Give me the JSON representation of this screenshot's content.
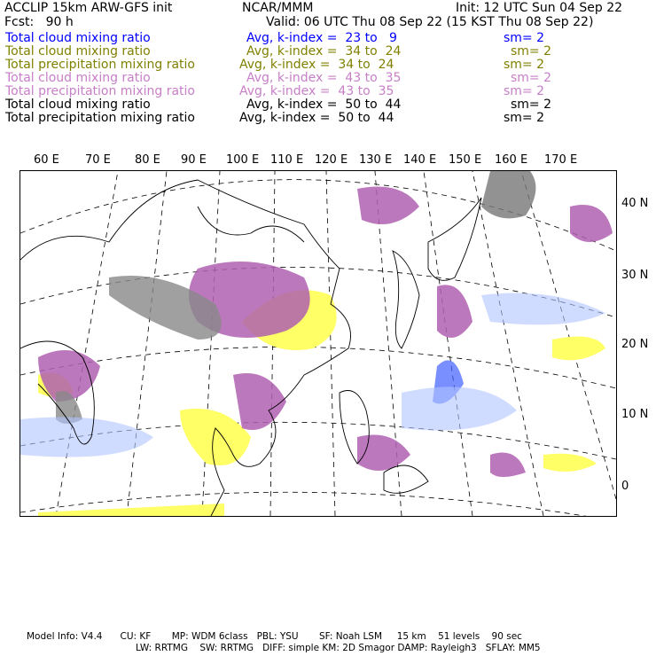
{
  "header": {
    "title": "ACCLIP 15km ARW-GFS init",
    "org": "NCAR/MMM",
    "init": "Init: 12 UTC Sun 04 Sep 22",
    "fcst": "Fcst:   90 h",
    "valid": "Valid: 06 UTC Thu 08 Sep 22 (15 KST Thu 08 Sep 22)"
  },
  "fields": [
    {
      "name": "Total cloud mixing ratio",
      "avg": "Avg, k-index =  23 to   9",
      "sm": "sm= 2",
      "color": "#0000ff"
    },
    {
      "name": "Total cloud mixing ratio",
      "avg": "Avg, k-index =  34 to  24",
      "sm": "sm= 2",
      "color": "#808000"
    },
    {
      "name": "Total precipitation mixing ratio",
      "avg": "Avg, k-index =  34 to  24",
      "sm": "sm= 2",
      "color": "#808000"
    },
    {
      "name": "Total cloud mixing ratio",
      "avg": "Avg, k-index =  43 to  35",
      "sm": "sm= 2",
      "color": "#c77fc7"
    },
    {
      "name": "Total precipitation mixing ratio",
      "avg": "Avg, k-index =  43 to  35",
      "sm": "sm= 2",
      "color": "#c77fc7"
    },
    {
      "name": "Total cloud mixing ratio",
      "avg": "Avg, k-index =  50 to  44",
      "sm": "sm= 2",
      "color": "#000000"
    },
    {
      "name": "Total precipitation mixing ratio",
      "avg": "Avg, k-index =  50 to  44",
      "sm": "sm= 2",
      "color": "#000000"
    }
  ],
  "map": {
    "lon_labels": [
      "60 E",
      "70 E",
      "80 E",
      "90 E",
      "100 E",
      "110 E",
      "120 E",
      "130 E",
      "140 E",
      "150 E",
      "160 E",
      "170 E"
    ],
    "lat_labels": [
      "40 N",
      "30 N",
      "20 N",
      "10 N",
      "0"
    ]
  },
  "footer": {
    "line1": "Model Info: V4.4      CU: KF       MP: WDM 6class   PBL: YSU       SF: Noah LSM     15 km    51 levels    90 sec",
    "line2": "LW: RRTMG    SW: RRTMG   DIFF: simple KM: 2D Smagor DAMP: Rayleigh3   SFLAY: MM5"
  }
}
